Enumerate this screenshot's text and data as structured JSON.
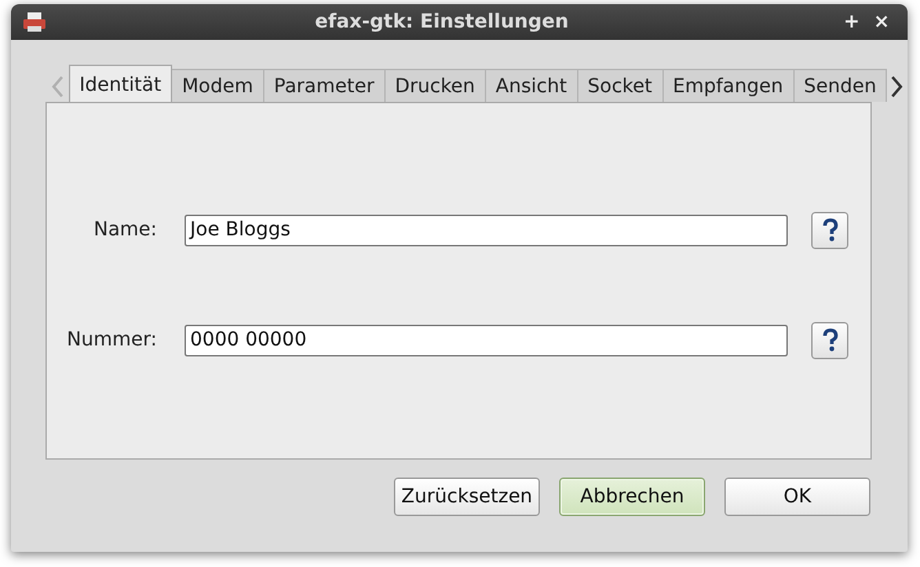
{
  "window": {
    "title": "efax-gtk: Einstellungen",
    "controls": [
      "+",
      "×"
    ]
  },
  "tabs": [
    {
      "label": "Identität",
      "selected": true
    },
    {
      "label": "Modem",
      "selected": false
    },
    {
      "label": "Parameter",
      "selected": false
    },
    {
      "label": "Drucken",
      "selected": false
    },
    {
      "label": "Ansicht",
      "selected": false
    },
    {
      "label": "Socket",
      "selected": false
    },
    {
      "label": "Empfangen",
      "selected": false
    },
    {
      "label": "Senden",
      "selected": false
    }
  ],
  "tab_scroll": {
    "left_disabled": true,
    "right_disabled": false
  },
  "fields": [
    {
      "label": "Name:",
      "value": "Joe Bloggs"
    },
    {
      "label": "Nummer:",
      "value": "0000 00000"
    }
  ],
  "buttons": [
    {
      "label": "Zurücksetzen",
      "focused": false
    },
    {
      "label": "Abbrechen",
      "focused": true
    },
    {
      "label": "OK",
      "focused": false
    }
  ]
}
